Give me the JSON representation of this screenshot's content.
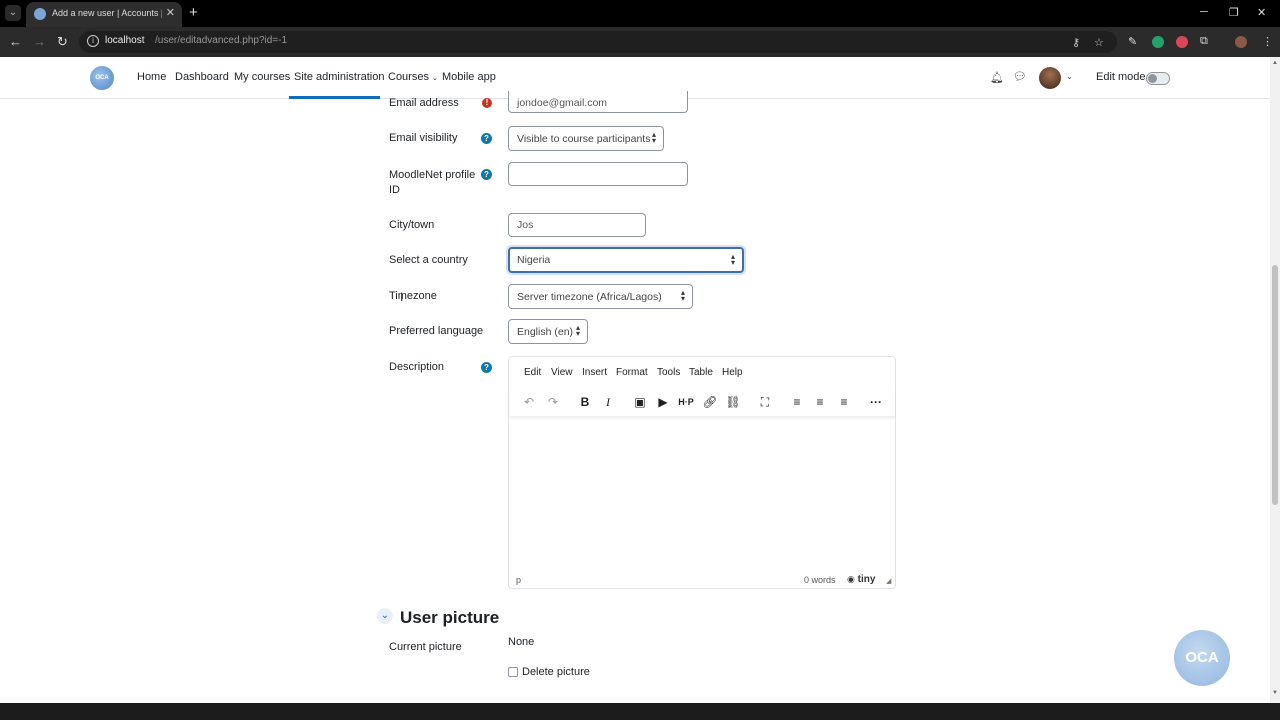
{
  "browser": {
    "tab_title": "Add a new user | Accounts | Us",
    "url_host": "localhost",
    "url_path": "/user/editadvanced.php?id=-1"
  },
  "navbar": {
    "logo_text": "OCA",
    "links": [
      "Home",
      "Dashboard",
      "My courses",
      "Site administration",
      "Courses",
      "Mobile app"
    ],
    "active": "Site administration",
    "edit_mode_label": "Edit mode"
  },
  "form": {
    "email_label": "Email address",
    "email_value": "jondoe@gmail.com",
    "email_visibility_label": "Email visibility",
    "email_visibility_value": "Visible to course participants",
    "moodlenet_label": "MoodleNet profile ID",
    "moodlenet_value": "",
    "city_label": "City/town",
    "city_value": "Jos",
    "country_label": "Select a country",
    "country_value": "Nigeria",
    "timezone_label": "Timezone",
    "timezone_value": "Server timezone (Africa/Lagos)",
    "language_label": "Preferred language",
    "language_value": "English (en)",
    "description_label": "Description"
  },
  "editor": {
    "menu": [
      "Edit",
      "View",
      "Insert",
      "Format",
      "Tools",
      "Table",
      "Help"
    ],
    "status_path": "p",
    "word_count": "0 words",
    "brand": "tiny",
    "toolbar_icons": [
      "undo-icon",
      "redo-icon",
      "bold-icon",
      "italic-icon",
      "image-icon",
      "media-icon",
      "h5p-icon",
      "link-icon",
      "unlink-icon",
      "fullscreen-icon",
      "align-left-icon",
      "align-center-icon",
      "align-right-icon",
      "more-icon"
    ]
  },
  "user_picture": {
    "section_title": "User picture",
    "current_picture_label": "Current picture",
    "current_picture_value": "None",
    "delete_picture_label": "Delete picture"
  },
  "floating_logo_text": "OCA",
  "colors": {
    "primary": "#0f6cbf",
    "required": "#ca3120",
    "help": "#1177a8"
  }
}
